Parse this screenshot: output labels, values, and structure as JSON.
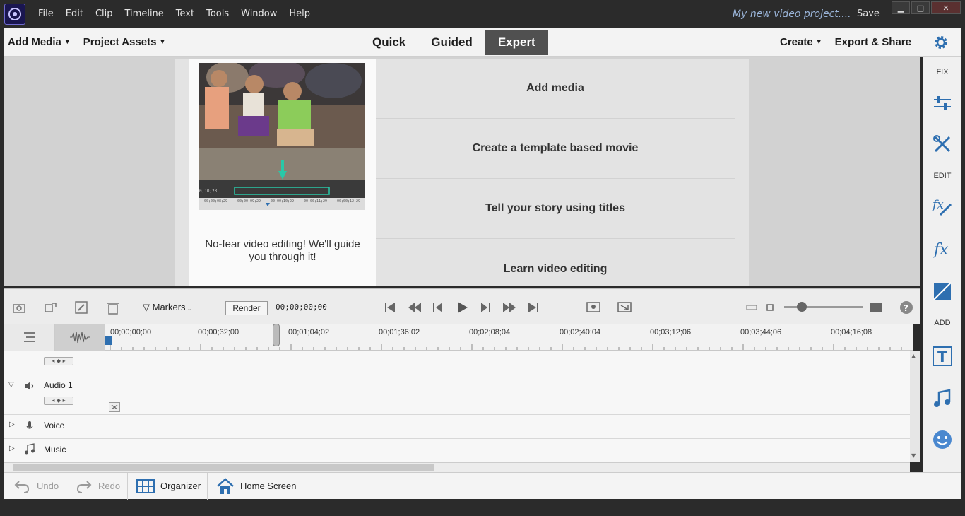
{
  "window": {
    "project_title": "My new video project....",
    "save_label": "Save",
    "minimize": "▁",
    "maximize": "□",
    "close": "✕"
  },
  "menu": [
    "File",
    "Edit",
    "Clip",
    "Timeline",
    "Text",
    "Tools",
    "Window",
    "Help"
  ],
  "modebar": {
    "add_media": "Add Media",
    "project_assets": "Project Assets",
    "tabs": [
      "Quick",
      "Guided",
      "Expert"
    ],
    "active_tab": "Expert",
    "create": "Create",
    "export_share": "Export & Share"
  },
  "guide": {
    "caption": "No-fear video editing! We'll guide you through it!",
    "thumb_timecode": "0;10;23",
    "thumb_ticks": [
      "00;00;08;29",
      "00;00;09;29",
      "00;00;10;29",
      "00;00;11;29",
      "00;00;12;29"
    ],
    "links": [
      "Add media",
      "Create a template based movie",
      "Tell your story using titles",
      "Learn video editing"
    ]
  },
  "right_panel": {
    "fix_label": "FIX",
    "edit_label": "EDIT",
    "add_label": "ADD",
    "icons": [
      "adjust-icon",
      "tools-icon",
      "fx-edit-icon",
      "fx-icon",
      "graphics-icon",
      "title-icon",
      "music-icon",
      "smiley-icon"
    ]
  },
  "timeline_toolbar": {
    "markers_label": "Markers",
    "render_label": "Render",
    "timecode": "00;00;00;00"
  },
  "ruler": {
    "labels": [
      "00;00;00;00",
      "00;00;32;00",
      "00;01;04;02",
      "00;01;36;02",
      "00;02;08;04",
      "00;02;40;04",
      "00;03;12;06",
      "00;03;44;06",
      "00;04;16;08"
    ]
  },
  "tracks": {
    "audio1": "Audio 1",
    "voice": "Voice",
    "music": "Music"
  },
  "bottombar": {
    "undo": "Undo",
    "redo": "Redo",
    "organizer": "Organizer",
    "home_screen": "Home Screen"
  },
  "colors": {
    "accent_blue": "#2e6fb0",
    "playhead_red": "#d33333",
    "active_tab_bg": "#505050",
    "title_blue": "#9ab4d8"
  }
}
